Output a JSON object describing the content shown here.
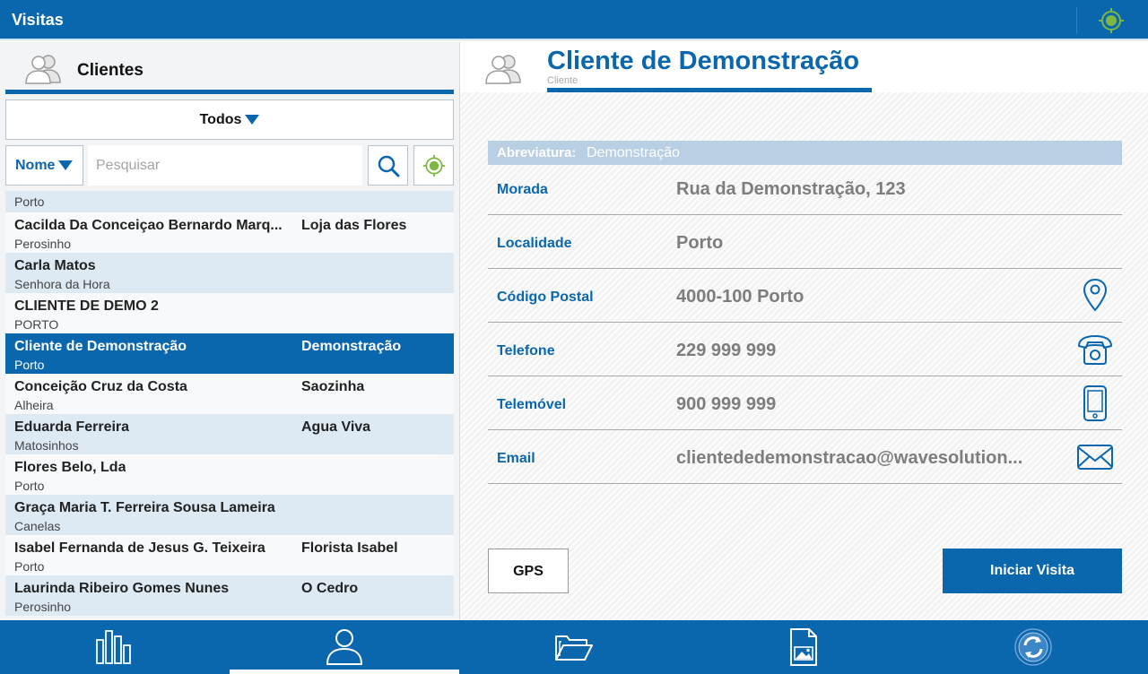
{
  "app": {
    "title": "Visitas"
  },
  "colors": {
    "primary": "#0b67ad",
    "row_alt": "#dde9f3",
    "gps_green": "#7db843"
  },
  "topbar": {
    "gps_icon": "gps-target-icon"
  },
  "left": {
    "header": {
      "label": "Clientes",
      "icon": "users-icon"
    },
    "filter": {
      "value": "Todos"
    },
    "sort": {
      "value": "Nome"
    },
    "search": {
      "placeholder": "Pesquisar"
    },
    "rows": [
      {
        "name": "",
        "city": "Porto",
        "abbr": ""
      },
      {
        "name": "Cacilda Da Conceiçao Bernardo Marq...",
        "city": "Perosinho",
        "abbr": "Loja das Flores"
      },
      {
        "name": "Carla Matos",
        "city": "Senhora da Hora",
        "abbr": ""
      },
      {
        "name": "CLIENTE DE DEMO 2",
        "city": "PORTO",
        "abbr": ""
      },
      {
        "name": "Cliente de Demonstração",
        "city": "Porto",
        "abbr": "Demonstração"
      },
      {
        "name": "Conceição Cruz da Costa",
        "city": "Alheira",
        "abbr": "Saozinha"
      },
      {
        "name": "Eduarda Ferreira",
        "city": "Matosinhos",
        "abbr": "Agua Viva"
      },
      {
        "name": "Flores Belo, Lda",
        "city": "Porto",
        "abbr": ""
      },
      {
        "name": "Graça Maria T. Ferreira Sousa Lameira",
        "city": "Canelas",
        "abbr": ""
      },
      {
        "name": "Isabel Fernanda de Jesus G. Teixeira",
        "city": "Porto",
        "abbr": "Florista Isabel"
      },
      {
        "name": "Laurinda  Ribeiro Gomes Nunes",
        "city": "Perosinho",
        "abbr": "O Cedro"
      }
    ]
  },
  "detail": {
    "title": "Cliente de Demonstração",
    "subtitle": "Cliente",
    "abreviatura": {
      "label": "Abreviatura:",
      "value": "Demonstração"
    },
    "fields": [
      {
        "label": "Morada",
        "value": "Rua da Demonstração, 123",
        "icon": ""
      },
      {
        "label": "Localidade",
        "value": "Porto",
        "icon": ""
      },
      {
        "label": "Código Postal",
        "value": "4000-100 Porto",
        "icon": "map-pin-icon"
      },
      {
        "label": "Telefone",
        "value": "229 999 999",
        "icon": "phone-icon"
      },
      {
        "label": "Telemóvel",
        "value": "900 999 999",
        "icon": "mobile-phone-icon"
      },
      {
        "label": "Email",
        "value": "clientededemonstracao@wavesolution...",
        "icon": "mail-icon"
      }
    ],
    "buttons": {
      "gps": "GPS",
      "start": "Iniciar Visita"
    }
  },
  "nav": {
    "items": [
      {
        "icon": "stats-bars-icon",
        "active": false
      },
      {
        "icon": "user-icon",
        "active": true
      },
      {
        "icon": "folder-icon",
        "active": false
      },
      {
        "icon": "image-document-icon",
        "active": false
      },
      {
        "icon": "sync-icon",
        "active": false
      }
    ]
  }
}
